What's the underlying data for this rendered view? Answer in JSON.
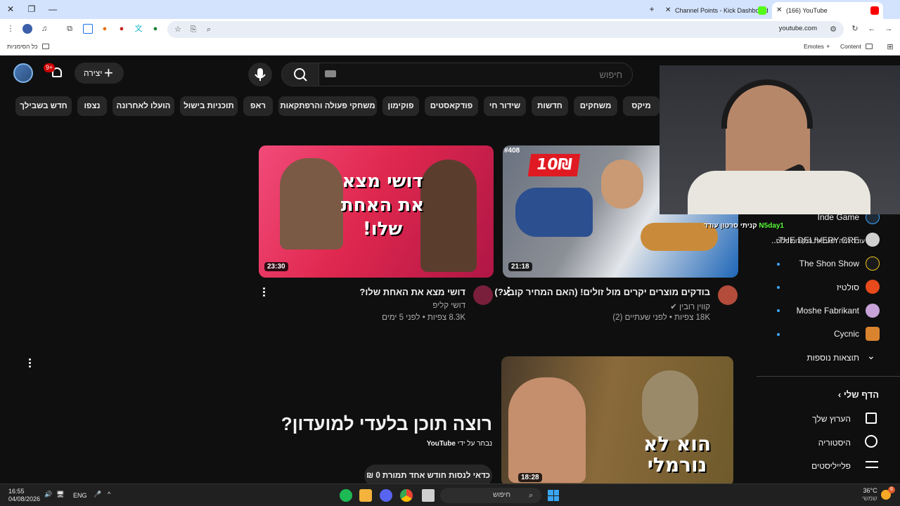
{
  "browser": {
    "tabs": [
      {
        "title": "Channel Points - Kick Dashboard",
        "active": false
      },
      {
        "title": "(166) YouTube",
        "active": true
      }
    ],
    "url": "youtube.com",
    "bookmarks": {
      "all_bookmarks": "כל הסימניות",
      "emotes": "Emotes",
      "content": "Content"
    }
  },
  "youtube": {
    "search": {
      "placeholder": "חיפוש"
    },
    "create_label": "יצירה",
    "notification_badge": "9+",
    "chips": [
      "מיקס",
      "משחקים",
      "חדשות",
      "שידור חי",
      "פודקאסטים",
      "פוקימון",
      "משחקי פעולה והרפתקאות",
      "ראפ",
      "תוכניות בישול",
      "הועלו לאחרונה",
      "נצפו",
      "חדש בשבילך"
    ],
    "videos": [
      {
        "title": "בודקים מוצרים יקרים מול זולים! (האם המחיר קובע?)",
        "channel": "קווין רובין",
        "meta": "18K צפיות • לפני שעתיים (2)",
        "duration": "21:18",
        "badge": "#408",
        "thumb_text": "10₪"
      },
      {
        "title": "דושי מצא את האחת שלו?",
        "channel": "דושי קליפ",
        "meta": "8.3K צפיות • לפני 5 ימים",
        "duration": "23:30",
        "thumb_text": "דושי מצא את האחת שלו!"
      },
      {
        "duration": "18:28",
        "thumb_text": "הוא לא נורמלי"
      }
    ],
    "promo": {
      "title": "רוצה תוכן בלעדי למועדון?",
      "by_label": "נבחר על ידי",
      "by_name": "YouTube",
      "cta": "כדאי לנסות חודש אחד תמורת 0 ₪"
    },
    "sidebar": {
      "subscriptions": [
        "Inde Game",
        "THE DELIVERY CRE...",
        "The Shon Show",
        "סולטיז",
        "Moshe Fabrikant",
        "Cycnic"
      ],
      "show_more": "תוצאות נוספות",
      "you_header": "הדף שלי",
      "you_items": [
        "הערוץ שלך",
        "היסטוריה",
        "פלייליסטים"
      ]
    },
    "overlay_chat": {
      "user": "N5day1",
      "line1": "קניתי סרטון עודד",
      "line2": "עודד דמה תנגב את הנקודות פלוס"
    }
  },
  "taskbar": {
    "time": "16:55",
    "date": "04/08/2026",
    "lang": "ENG",
    "search_placeholder": "חיפוש",
    "weather_temp": "36°C",
    "weather_desc": "שמשי",
    "weather_badge": "6"
  },
  "colors": {
    "yt_bg": "#0f0f0f",
    "chip_bg": "#272727",
    "accent_red": "#cc0000",
    "link_blue": "#3ea6ff",
    "tab_strip": "#d3e3fd"
  }
}
